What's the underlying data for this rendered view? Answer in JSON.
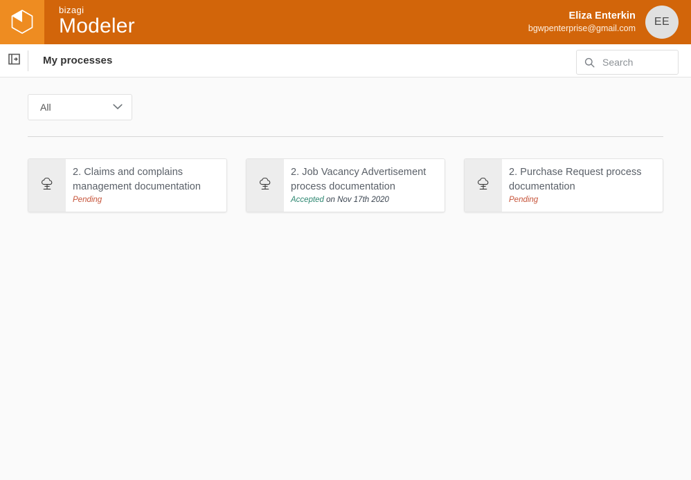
{
  "colors": {
    "brand_orange_dark": "#d2650a",
    "brand_orange_light": "#ee8c21",
    "status_pending": "#c6543a",
    "status_accepted": "#2f8872",
    "page_background": "#fafafa",
    "card_icon_panel": "#ededed"
  },
  "topbar": {
    "logo_icon": "cube-hexagon-icon",
    "brand_sub": "bizagi",
    "brand_main": "Modeler",
    "user": {
      "name": "Eliza Enterkin",
      "email": "bgwpenterprise@gmail.com",
      "initials": "EE"
    }
  },
  "subheader": {
    "panel_toggle_icon": "panel-expand-icon",
    "title": "My processes",
    "search": {
      "icon": "search-icon",
      "placeholder": "Search",
      "value": ""
    }
  },
  "filters": {
    "status_select": {
      "selected": "All",
      "chevron_icon": "chevron-down-icon",
      "options": [
        "All"
      ]
    }
  },
  "processes": [
    {
      "icon": "cloud-publish-icon",
      "title": "2. Claims and complains management documentation",
      "status_type": "pending",
      "status_label": "Pending",
      "status_detail": ""
    },
    {
      "icon": "cloud-publish-icon",
      "title": "2. Job Vacancy Advertisement process documentation",
      "status_type": "accepted",
      "status_label": "Accepted",
      "status_detail": " on Nov 17th 2020"
    },
    {
      "icon": "cloud-publish-icon",
      "title": "2. Purchase Request process documentation",
      "status_type": "pending",
      "status_label": "Pending",
      "status_detail": ""
    }
  ]
}
